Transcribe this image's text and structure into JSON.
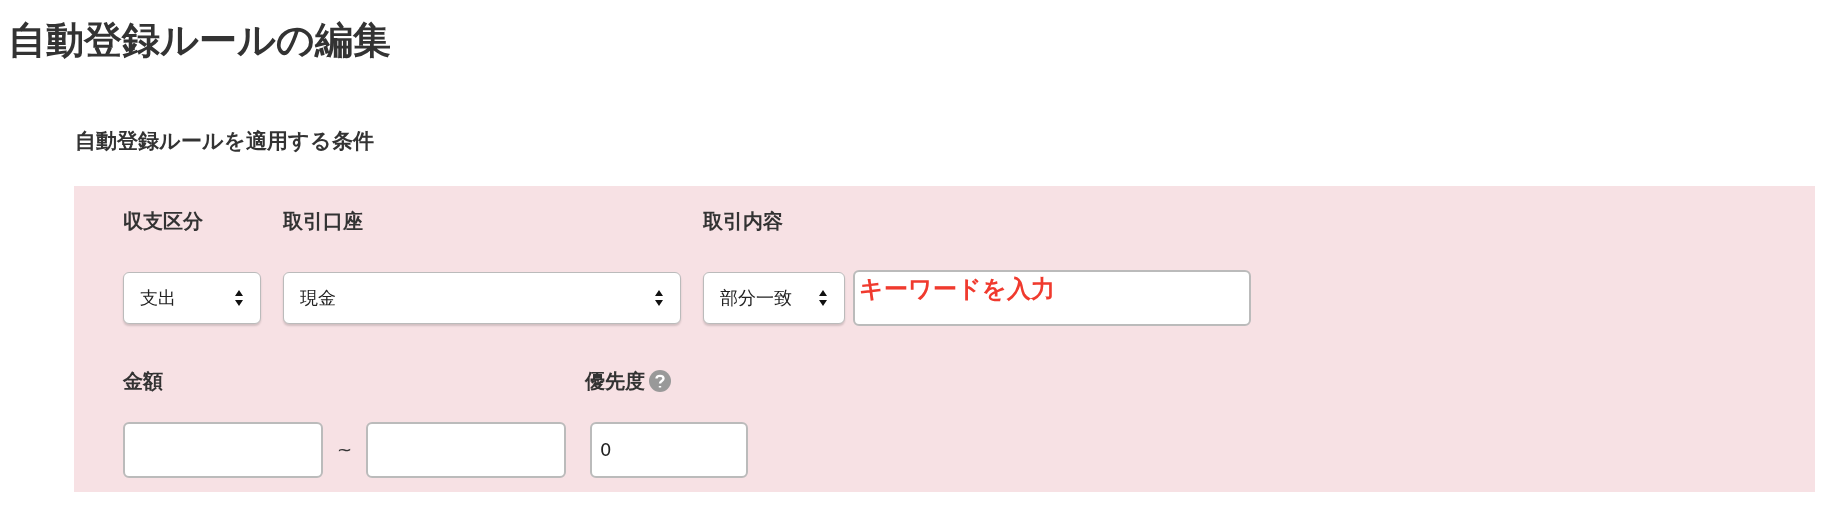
{
  "title": "自動登録ルールの編集",
  "section": {
    "heading": "自動登録ルールを適用する条件",
    "row1": [
      {
        "label": "収支区分",
        "kind": "select",
        "value": "支出"
      },
      {
        "label": "取引口座",
        "kind": "select",
        "value": "現金"
      },
      {
        "label": "取引内容",
        "kind": "select",
        "value": "部分一致"
      }
    ],
    "keyword": {
      "annotation": "キーワードを入力"
    },
    "amount": {
      "label": "金額",
      "separator": "~"
    },
    "priority": {
      "label": "優先度",
      "value": "0"
    }
  }
}
